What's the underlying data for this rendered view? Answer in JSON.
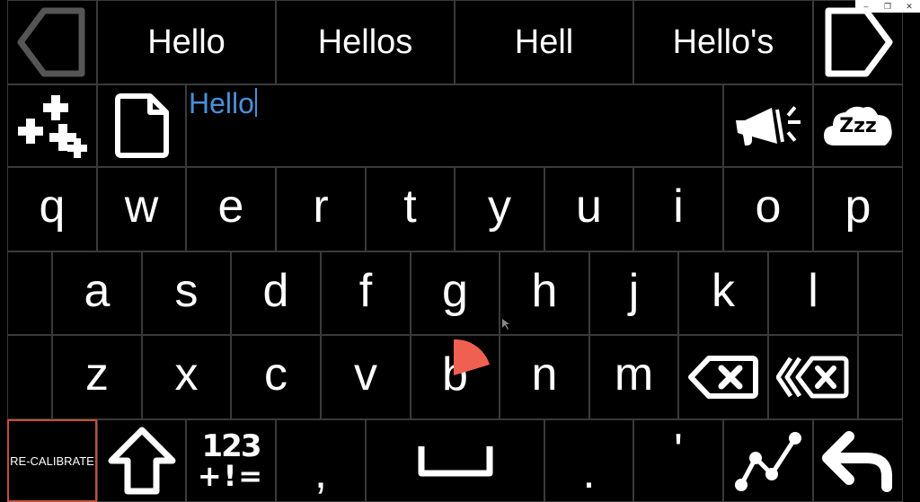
{
  "window": {
    "minimize_icon": "minimize-icon",
    "restore_icon": "restore-icon",
    "close_icon": "close-icon"
  },
  "suggestions": {
    "prev_icon": "left-arrow-icon",
    "next_icon": "right-arrow-icon",
    "items": [
      "Hello",
      "Hellos",
      "Hell",
      "Hello's"
    ]
  },
  "toolbar": {
    "add_phrases_icon": "plus-cluster-icon",
    "document_icon": "document-icon",
    "speak_icon": "megaphone-icon",
    "sleep_label": "Zzz"
  },
  "text_box": {
    "value": "Hello"
  },
  "rows": {
    "row1": [
      "q",
      "w",
      "e",
      "r",
      "t",
      "y",
      "u",
      "i",
      "o",
      "p"
    ],
    "row2": [
      "a",
      "s",
      "d",
      "f",
      "g",
      "h",
      "j",
      "k",
      "l"
    ],
    "row3": [
      "z",
      "x",
      "c",
      "v",
      "b",
      "n",
      "m"
    ]
  },
  "row3_icons": {
    "backspace_icon": "backspace-icon",
    "delete_word_icon": "delete-word-icon"
  },
  "bottom": {
    "recalibrate_label": "RE-CALIBRATE",
    "shift_icon": "shift-arrow-icon",
    "numbers_label_top": "123",
    "numbers_label_bottom": "+!=",
    "comma": ",",
    "space_icon": "space-bar-icon",
    "period": ".",
    "apostrophe": "'",
    "swipe_icon": "line-graph-icon",
    "enter_icon": "return-arrow-icon"
  },
  "colors": {
    "background": "#000000",
    "grid_line": "#3a3a3a",
    "text_blue": "#4a90d9",
    "recalibrate_border": "#c0503a",
    "pointer": "#f06050",
    "prev_arrow": "#555555"
  }
}
